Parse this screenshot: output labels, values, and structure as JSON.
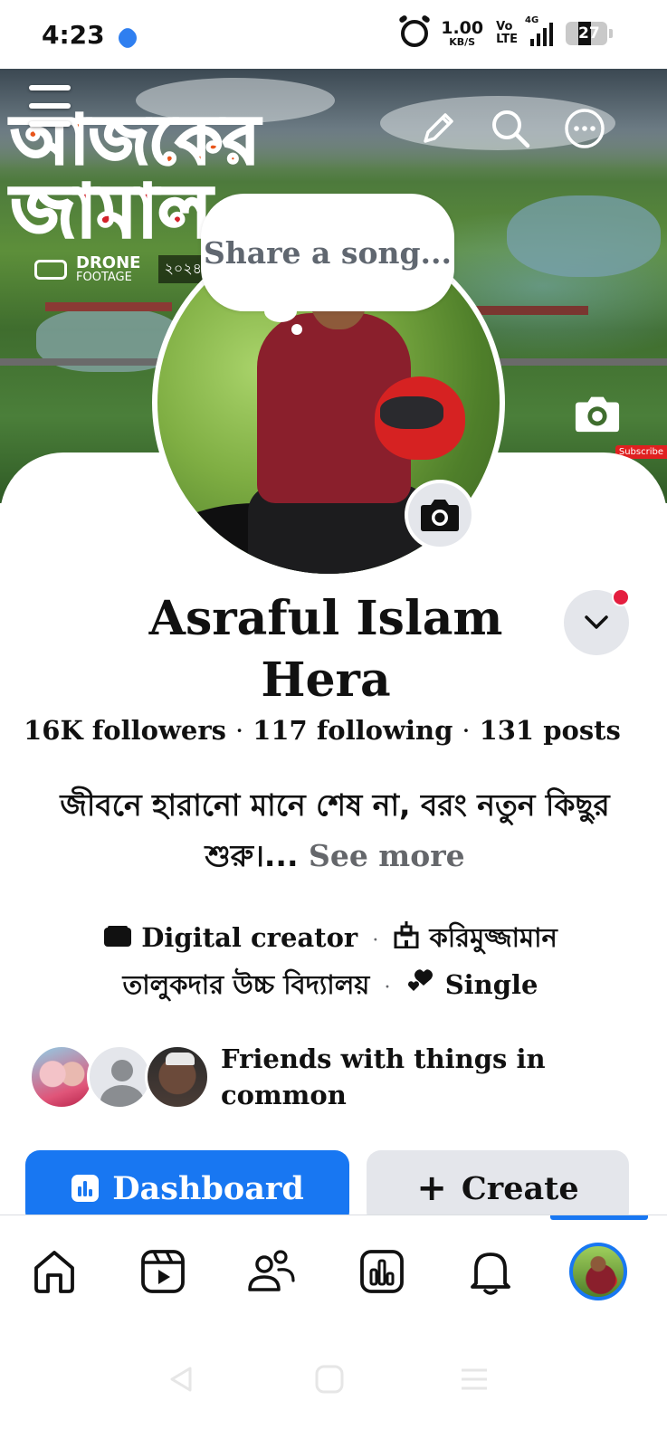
{
  "status_bar": {
    "time": "4:23",
    "net_speed_value": "1.00",
    "net_speed_unit": "KB/S",
    "volte_top": "Vo",
    "volte_bottom": "LTE",
    "network_type": "4G",
    "battery": "27"
  },
  "cover": {
    "title_line1": "আজকের",
    "title_line2": "জামাল",
    "drone_label": "DRONE",
    "drone_sublabel": "FOOTAGE",
    "year_fragment": "২০২৪",
    "subscribe_fragment": "Subscribe"
  },
  "song_prompt": "Share a song...",
  "profile": {
    "name": "Asraful Islam Hera",
    "stats": {
      "followers": "16K followers",
      "following": "117 following",
      "posts": "131 posts",
      "separator": "·"
    },
    "bio": "জীবনে হারানো মানে শেষ না, বরং নতুন কিছুর শুরু।...",
    "see_more": "See more",
    "details": {
      "category": "Digital creator",
      "school_line1": "করিমুজ্জামান",
      "school_line2": "তালুকদার উচ্চ বিদ্যালয়",
      "relationship": "Single"
    },
    "friends_text": "Friends with things in common"
  },
  "actions": {
    "dashboard_label": "Dashboard",
    "create_label": "Create"
  },
  "bottom_nav": {
    "items": [
      "home-icon",
      "reels-icon",
      "friends-icon",
      "dashboard-icon",
      "notifications-icon",
      "profile-avatar"
    ],
    "active": "profile-avatar"
  },
  "colors": {
    "accent": "#1877f2",
    "secondary_button": "#e4e6eb",
    "notification_dot": "#e41e3f",
    "muted_text": "#65676b"
  }
}
